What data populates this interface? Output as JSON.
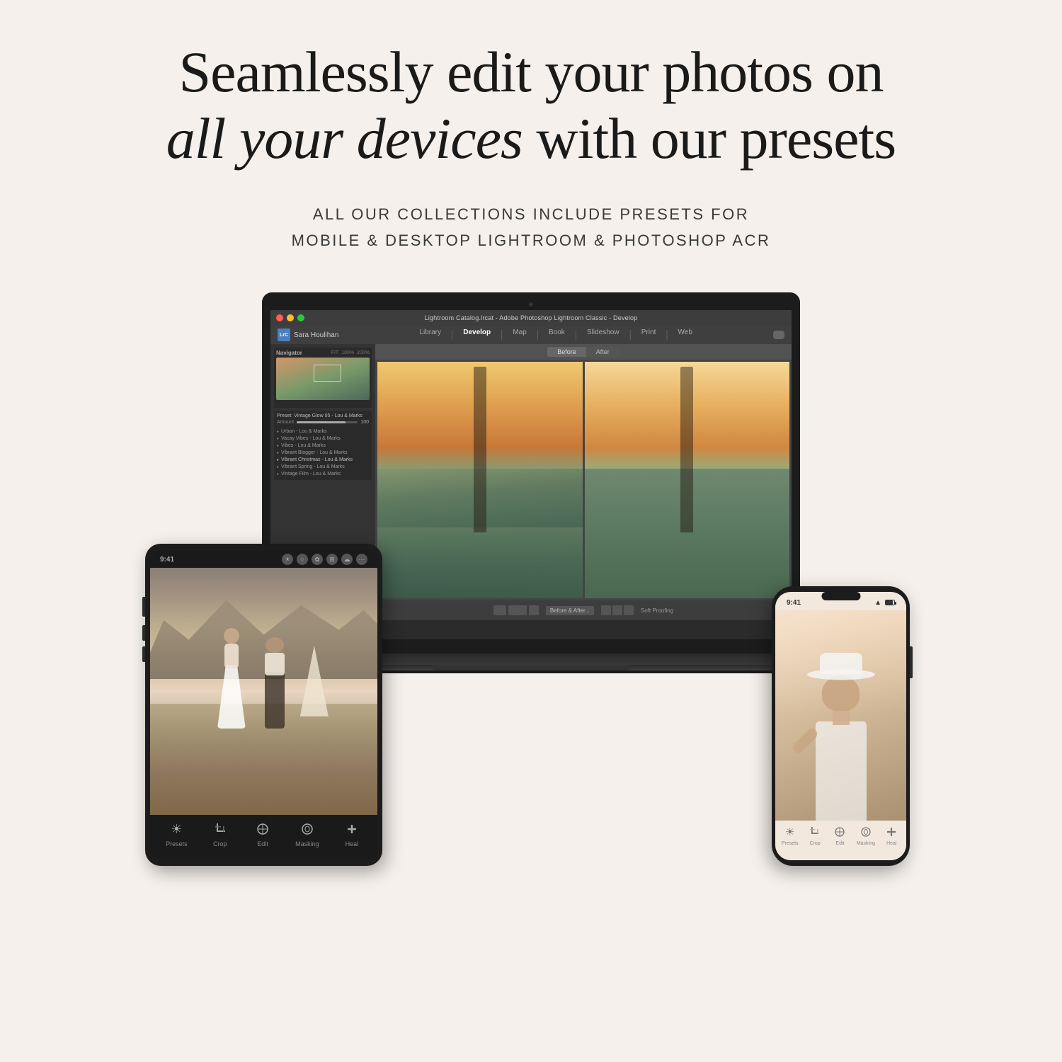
{
  "page": {
    "background_color": "#f5f0eb"
  },
  "header": {
    "main_title_line1": "Seamlessly edit your photos on",
    "main_title_line2_italic": "all your devices",
    "main_title_line2_regular": " with our presets",
    "subtitle_line1": "ALL OUR COLLECTIONS INCLUDE PRESETS FOR",
    "subtitle_line2": "MOBILE & DESKTOP LIGHTROOM & PHOTOSHOP ACR"
  },
  "lightroom": {
    "titlebar": "Lightroom Catalog.lrcat - Adobe Photoshop Lightroom Classic - Develop",
    "username": "Sara Houlihan",
    "brand": "LrC",
    "nav_items": [
      "Library",
      "Develop",
      "Map",
      "Book",
      "Slideshow",
      "Print",
      "Web"
    ],
    "active_nav": "Develop",
    "navigator_label": "Navigator",
    "preset_label": "Preset: Vintage Glow 05 - Lou & Marks",
    "amount_label": "Amount",
    "amount_value": "100",
    "preset_list": [
      "Urban - Lou & Marks",
      "Vacay Vibes - Lou & Marks",
      "Vibes - Lou & Marks",
      "Vibrant Blogger - Lou & Marks",
      "Vibrant Christmas - Lou & Marks",
      "Vibrant Spring - Lou & Marks",
      "Vintage Film - Lou & Marks"
    ],
    "before_label": "Before",
    "after_label": "After",
    "before_after_btn": "Before & After...",
    "soft_proofing": "Soft Proofing"
  },
  "ipad": {
    "time": "9:41",
    "toolbar_items": [
      "Presets",
      "Crop",
      "Edit",
      "Masking",
      "Heal"
    ],
    "toolbar_icons": [
      "☀",
      "⊡",
      "✦",
      "◈",
      "✚"
    ]
  },
  "phone": {
    "time": "9:41",
    "toolbar_items": [
      "Presets",
      "Crop",
      "Edit",
      "Masking",
      "Heal"
    ],
    "toolbar_icons": [
      "☀",
      "⊡",
      "✦",
      "◈",
      "✚"
    ]
  }
}
